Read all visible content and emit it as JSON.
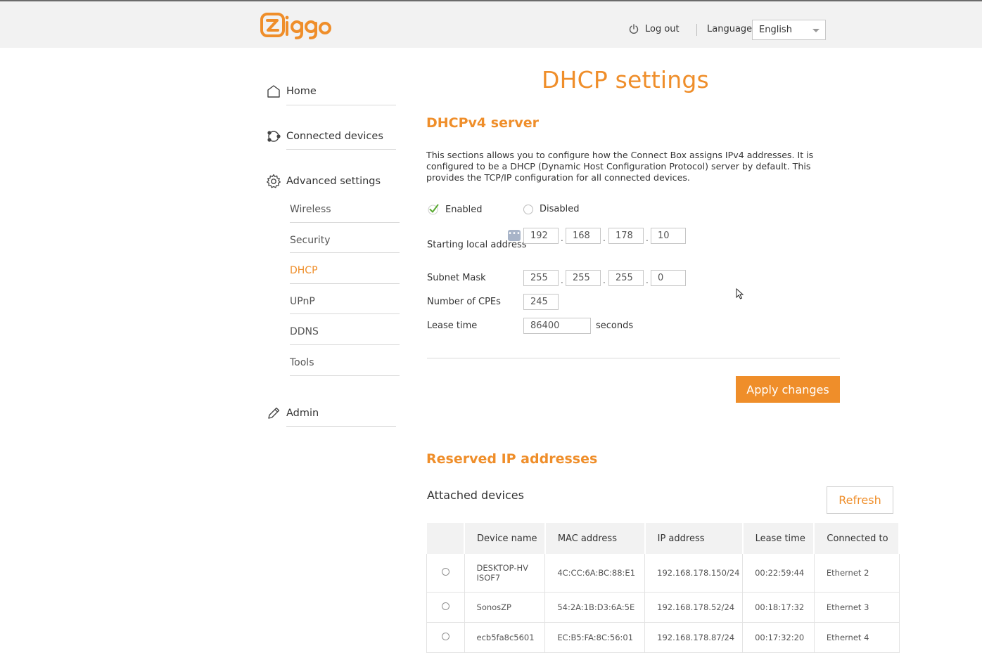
{
  "header": {
    "brand": "ziggo",
    "logout_label": "Log out",
    "language_label": "Language",
    "language_value": "English"
  },
  "sidebar": {
    "main_items": [
      {
        "label": "Home",
        "icon": "home-icon"
      },
      {
        "label": "Connected devices",
        "icon": "devices-icon"
      },
      {
        "label": "Advanced settings",
        "icon": "gear-icon"
      },
      {
        "label": "Admin",
        "icon": "pencil-icon"
      }
    ],
    "sub_items": [
      {
        "label": "Wireless"
      },
      {
        "label": "Security"
      },
      {
        "label": "DHCP",
        "active": true
      },
      {
        "label": "UPnP"
      },
      {
        "label": "DDNS"
      },
      {
        "label": "Tools"
      }
    ]
  },
  "page": {
    "title": "DHCP settings",
    "dhcp_section_title": "DHCPv4 server",
    "description": "This sections allows you to configure how the Connect Box assigns IPv4 addresses. It is configured to be a DHCP (Dynamic Host Configuration Protocol) server by default. This provides the TCP/IP configuration for all connected devices.",
    "enabled_label": "Enabled",
    "disabled_label": "Disabled",
    "enabled_selected": true,
    "starting_label": "Starting local address",
    "starting_octets": [
      "192",
      "168",
      "178",
      "10"
    ],
    "subnet_label": "Subnet Mask",
    "subnet_octets": [
      "255",
      "255",
      "255",
      "0"
    ],
    "cpes_label": "Number of CPEs",
    "cpes_value": "245",
    "lease_label": "Lease time",
    "lease_value": "86400",
    "lease_unit": "seconds",
    "apply_label": "Apply changes",
    "reserved_title": "Reserved IP addresses",
    "attached_title": "Attached devices",
    "refresh_label": "Refresh"
  },
  "table": {
    "columns": [
      "Device name",
      "MAC address",
      "IP address",
      "Lease time",
      "Connected to"
    ],
    "rows": [
      {
        "name": "DESKTOP-HVISOF7",
        "mac": "4C:CC:6A:BC:88:E1",
        "ip": "192.168.178.150/24",
        "lease": "00:22:59:44",
        "conn": "Ethernet 2"
      },
      {
        "name": "SonosZP",
        "mac": "54:2A:1B:D3:6A:5E",
        "ip": "192.168.178.52/24",
        "lease": "00:18:17:32",
        "conn": "Ethernet 3"
      },
      {
        "name": "ecb5fa8c5601",
        "mac": "EC:B5:FA:8C:56:01",
        "ip": "192.168.178.87/24",
        "lease": "00:17:32:20",
        "conn": "Ethernet 4"
      }
    ]
  },
  "colors": {
    "accent": "#ef8e2a",
    "header_bg": "#f2f2f2",
    "text": "#333333"
  }
}
